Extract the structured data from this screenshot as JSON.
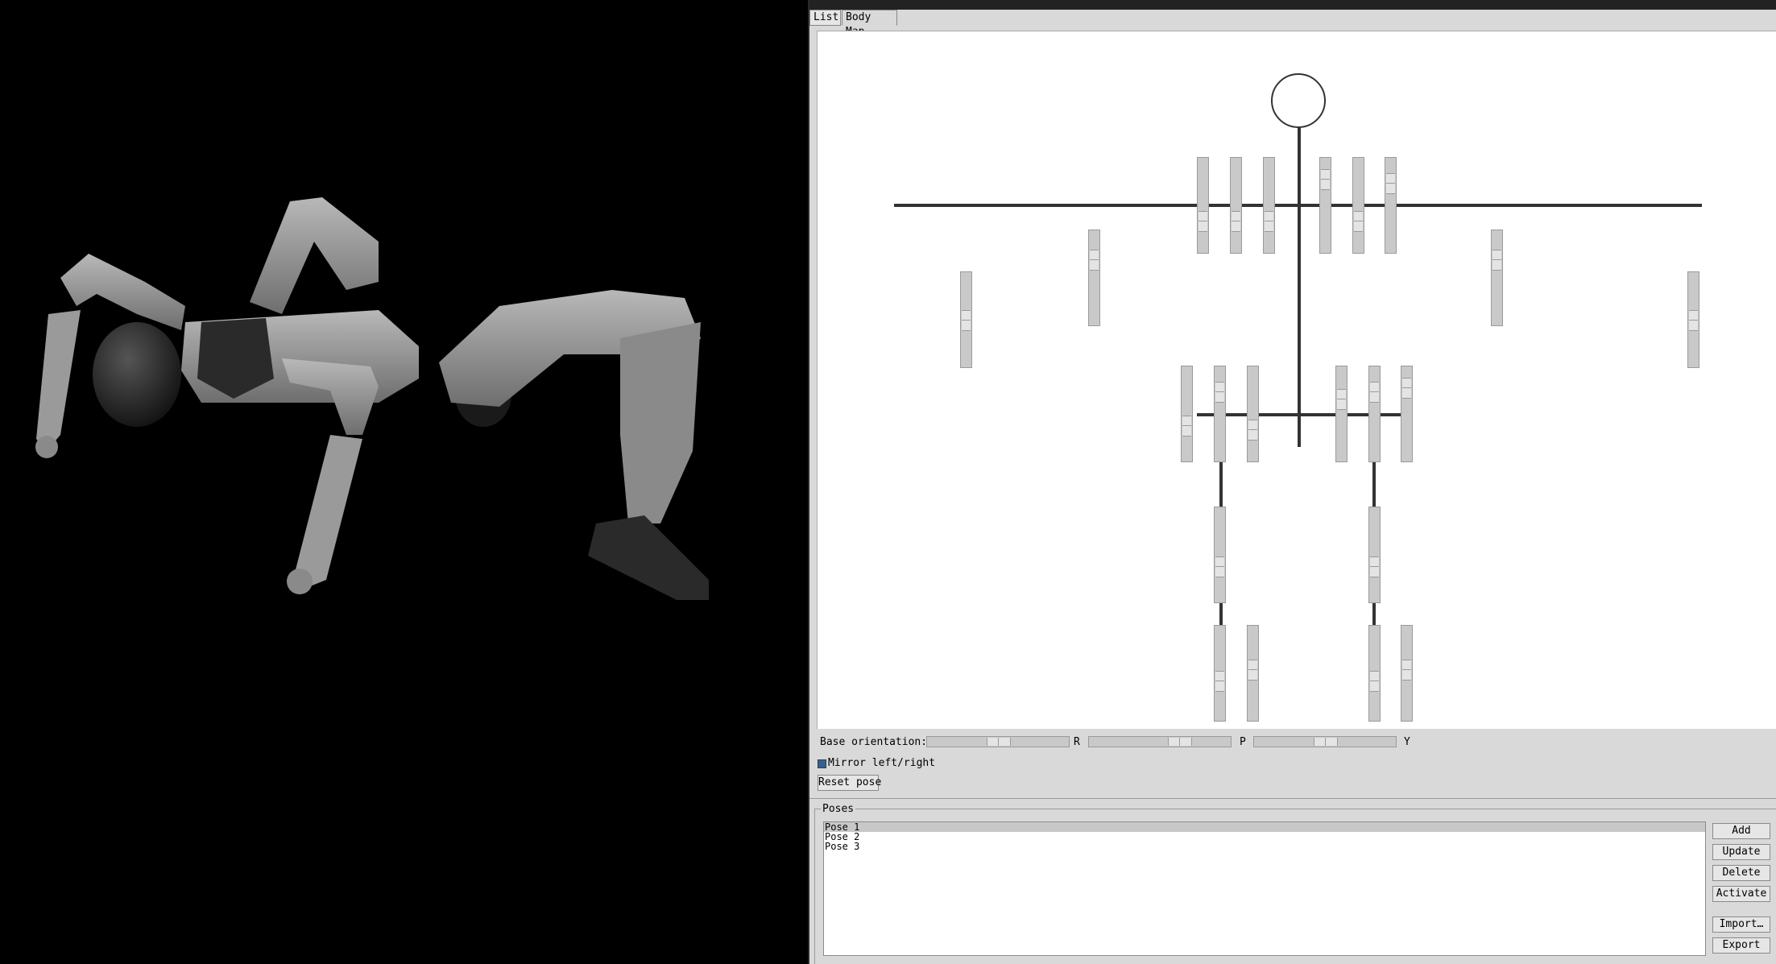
{
  "tabs": [
    {
      "label": "List",
      "active": false
    },
    {
      "label": "Body Map",
      "active": true
    }
  ],
  "base_orientation": {
    "label": "Base orientation:",
    "sliders": [
      {
        "axis": "R",
        "value": 0.5
      },
      {
        "axis": "P",
        "value": 0.66
      },
      {
        "axis": "Y",
        "value": 0.5
      }
    ]
  },
  "mirror": {
    "label": "Mirror left/right",
    "checked": true
  },
  "reset_label": "Reset pose",
  "poses": {
    "title": "Poses",
    "items": [
      "Pose 1",
      "Pose 2",
      "Pose 3"
    ],
    "selected_index": 0,
    "buttons": {
      "add": "Add",
      "update": "Update",
      "delete": "Delete",
      "activate": "Activate",
      "import": "Import…",
      "export": "Export"
    }
  },
  "body_map": {
    "joints": [
      {
        "name": "torso-joint-1",
        "value": 0.7
      },
      {
        "name": "torso-joint-2",
        "value": 0.7
      },
      {
        "name": "torso-joint-3",
        "value": 0.7
      },
      {
        "name": "torso-joint-4",
        "value": 0.15
      },
      {
        "name": "torso-joint-5",
        "value": 0.7
      },
      {
        "name": "torso-joint-6",
        "value": 0.2
      },
      {
        "name": "right-elbow-joint",
        "value": 0.5
      },
      {
        "name": "right-shoulder-joint",
        "value": 0.25
      },
      {
        "name": "left-shoulder-joint",
        "value": 0.25
      },
      {
        "name": "left-elbow-joint",
        "value": 0.5
      },
      {
        "name": "right-hip-joint-1",
        "value": 0.65
      },
      {
        "name": "right-hip-joint-2",
        "value": 0.2
      },
      {
        "name": "right-hip-joint-3",
        "value": 0.7
      },
      {
        "name": "left-hip-joint-1",
        "value": 0.3
      },
      {
        "name": "left-hip-joint-2",
        "value": 0.2
      },
      {
        "name": "left-hip-joint-3",
        "value": 0.15
      },
      {
        "name": "right-knee-joint",
        "value": 0.65
      },
      {
        "name": "left-knee-joint",
        "value": 0.65
      },
      {
        "name": "right-ankle-joint-1",
        "value": 0.6
      },
      {
        "name": "right-ankle-joint-2",
        "value": 0.45
      },
      {
        "name": "left-ankle-joint-1",
        "value": 0.6
      },
      {
        "name": "left-ankle-joint-2",
        "value": 0.45
      }
    ]
  }
}
